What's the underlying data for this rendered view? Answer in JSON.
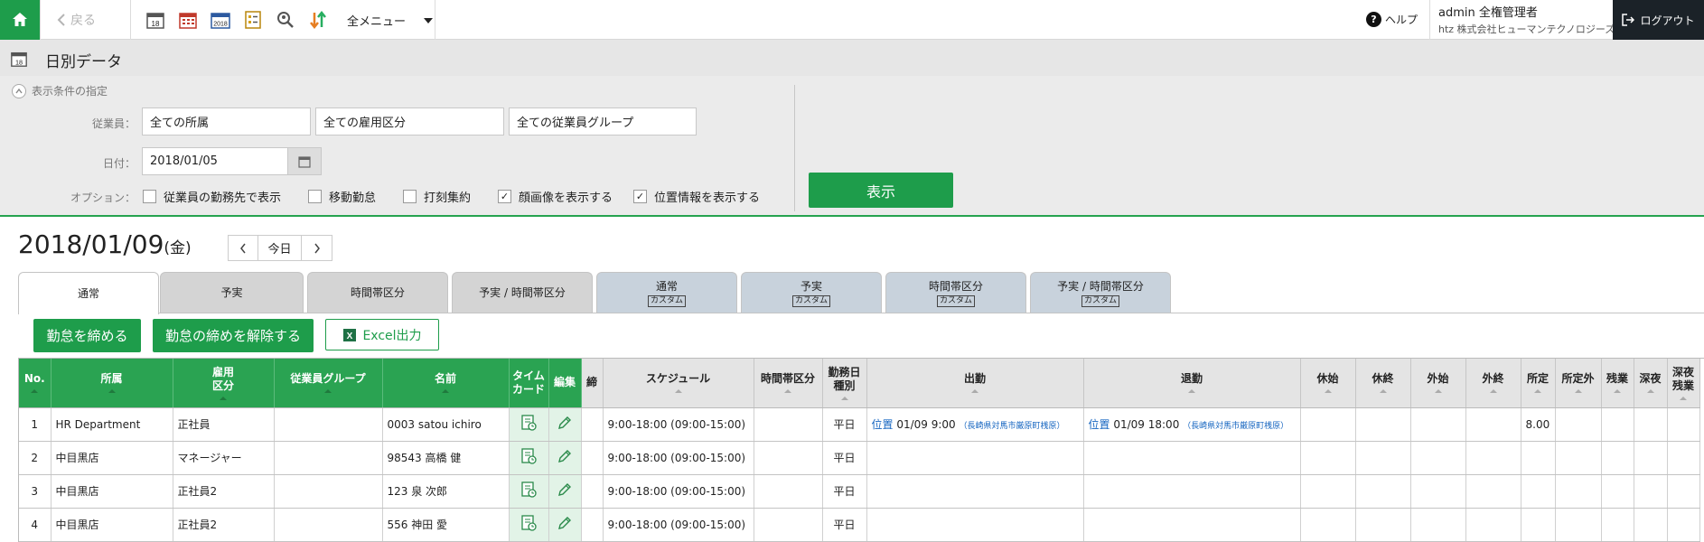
{
  "topbar": {
    "back_label": "戻る",
    "menu_label": "全メニュー",
    "help_label": "ヘルプ",
    "user_line1": "admin 全権管理者",
    "user_line2": "htz 株式会社ヒューマンテクノロジーズ",
    "logout_label": "ログアウト",
    "icons": [
      "calendar-day-icon",
      "calendar-month-icon",
      "calendar-year-icon",
      "checklist-icon",
      "search-person-icon",
      "sort-arrows-icon"
    ],
    "brand_color": "#1e9d4b"
  },
  "page": {
    "title": "日別データ"
  },
  "conditions": {
    "header": "表示条件の指定",
    "employee_label": "従業員：",
    "employee_fields": [
      "全ての所属",
      "全ての雇用区分",
      "全ての従業員グループ"
    ],
    "date_label": "日付：",
    "date_value": "2018/01/05",
    "options_label": "オプション：",
    "options": [
      {
        "label": "従業員の勤務先で表示",
        "checked": false
      },
      {
        "label": "移動勤怠",
        "checked": false
      },
      {
        "label": "打刻集約",
        "checked": false
      },
      {
        "label": "顔画像を表示する",
        "checked": true
      },
      {
        "label": "位置情報を表示する",
        "checked": true
      }
    ],
    "show_button": "表示"
  },
  "date_header": {
    "date": "2018/01/09",
    "weekday": "(金)",
    "today_label": "今日"
  },
  "tabs": [
    {
      "label": "通常",
      "sub": "",
      "active": true
    },
    {
      "label": "予実",
      "sub": ""
    },
    {
      "label": "時間帯区分",
      "sub": ""
    },
    {
      "label": "予実 / 時間帯区分",
      "sub": ""
    },
    {
      "label": "通常",
      "sub": "カスタム"
    },
    {
      "label": "予実",
      "sub": "カスタム"
    },
    {
      "label": "時間帯区分",
      "sub": "カスタム"
    },
    {
      "label": "予実 / 時間帯区分",
      "sub": "カスタム"
    }
  ],
  "actions": {
    "close_label": "勤怠を締める",
    "unclose_label": "勤怠の締めを解除する",
    "excel_label": "Excel出力"
  },
  "table": {
    "columns": [
      "No.",
      "所属",
      "雇用\n区分",
      "従業員グループ",
      "名前",
      "タイム\nカード",
      "編集",
      "締",
      "スケジュール",
      "時間帯区分",
      "勤務日\n種別",
      "出勤",
      "退勤",
      "休始",
      "休終",
      "外始",
      "外終",
      "所定",
      "所定外",
      "残業",
      "深夜",
      "深夜\n残業"
    ],
    "rows": [
      {
        "no": "1",
        "dept": "HR Department",
        "emp_type": "正社員",
        "group": "",
        "name": "0003 satou ichiro",
        "schedule": "9:00-18:00 (09:00-15:00)",
        "day_type": "平日",
        "in_loc": "位置",
        "in_time": "01/09  9:00",
        "in_addr": "（長崎県対馬市厳原町桟原）",
        "out_loc": "位置",
        "out_time": "01/09 18:00",
        "out_addr": "（長崎県対馬市厳原町桟原）",
        "fixed": "8.00"
      },
      {
        "no": "2",
        "dept": "中目黒店",
        "emp_type": "マネージャー",
        "group": "",
        "name": "98543 高橋 健",
        "schedule": "9:00-18:00 (09:00-15:00)",
        "day_type": "平日"
      },
      {
        "no": "3",
        "dept": "中目黒店",
        "emp_type": "正社員2",
        "group": "",
        "name": "123 泉 次郎",
        "schedule": "9:00-18:00 (09:00-15:00)",
        "day_type": "平日"
      },
      {
        "no": "4",
        "dept": "中目黒店",
        "emp_type": "正社員2",
        "group": "",
        "name": "556 神田 愛",
        "schedule": "9:00-18:00 (09:00-15:00)",
        "day_type": "平日"
      }
    ]
  }
}
